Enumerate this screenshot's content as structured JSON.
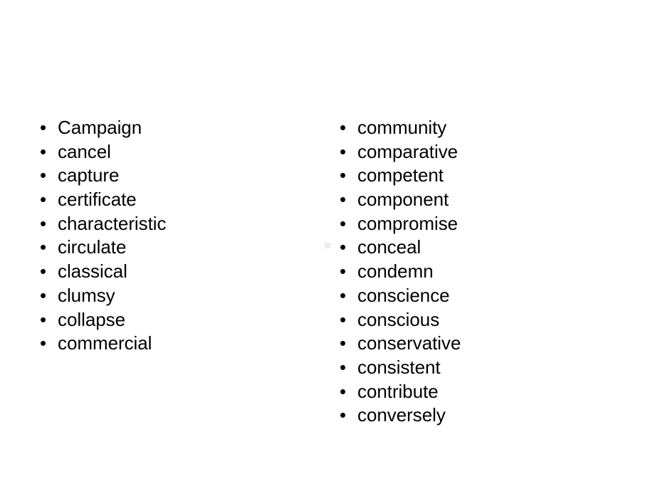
{
  "slide": {
    "background_color": "#ffffff",
    "text_color": "#000000",
    "bullet_glyph": "•",
    "artifact_color": "#ececec"
  },
  "columns": [
    {
      "name": "left-column",
      "items": [
        {
          "bullet": "•",
          "label": "Campaign"
        },
        {
          "bullet": "•",
          "label": "cancel"
        },
        {
          "bullet": "•",
          "label": "capture"
        },
        {
          "bullet": "•",
          "label": "certificate"
        },
        {
          "bullet": "•",
          "label": "characteristic"
        },
        {
          "bullet": "•",
          "label": "circulate"
        },
        {
          "bullet": "•",
          "label": "classical"
        },
        {
          "bullet": "•",
          "label": "clumsy"
        },
        {
          "bullet": "•",
          "label": "collapse"
        },
        {
          "bullet": "•",
          "label": "commercial"
        }
      ]
    },
    {
      "name": "right-column",
      "items": [
        {
          "bullet": "•",
          "label": "community"
        },
        {
          "bullet": "•",
          "label": "comparative"
        },
        {
          "bullet": "•",
          "label": "competent"
        },
        {
          "bullet": "•",
          "label": "component"
        },
        {
          "bullet": "•",
          "label": "compromise"
        },
        {
          "bullet": "•",
          "label": "conceal"
        },
        {
          "bullet": "•",
          "label": "condemn"
        },
        {
          "bullet": "•",
          "label": "conscience"
        },
        {
          "bullet": "•",
          "label": "conscious"
        },
        {
          "bullet": "•",
          "label": "conservative"
        },
        {
          "bullet": "•",
          "label": "consistent"
        },
        {
          "bullet": "•",
          "label": "contribute"
        },
        {
          "bullet": "•",
          "label": "conversely"
        }
      ]
    }
  ]
}
